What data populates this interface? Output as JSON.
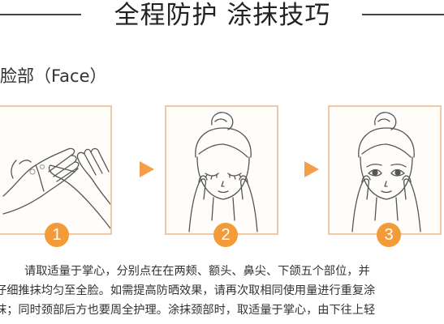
{
  "header": {
    "title": "全程防护 涂抹技巧"
  },
  "section": {
    "label": "脸部（Face）"
  },
  "steps": [
    {
      "number": "1",
      "illustration": "hands-icon"
    },
    {
      "number": "2",
      "illustration": "face-eyes-closed-icon"
    },
    {
      "number": "3",
      "illustration": "face-eyes-open-icon"
    }
  ],
  "instructions": {
    "lines": [
      "请取适量于掌心，分别点在在两颊、额头、鼻尖、下颌五个部位，并",
      "仔细推抹均匀至全脸。如需提高防晒效果，请再次取相同使用量进行重复涂",
      "抹；同时颈部后方也要周全护理。涂抹颈部时，取适量于掌心，由下往上轻"
    ]
  },
  "colors": {
    "accent": "#f29b38",
    "panel_border": "#efc9a7",
    "line_art": "#555555"
  }
}
